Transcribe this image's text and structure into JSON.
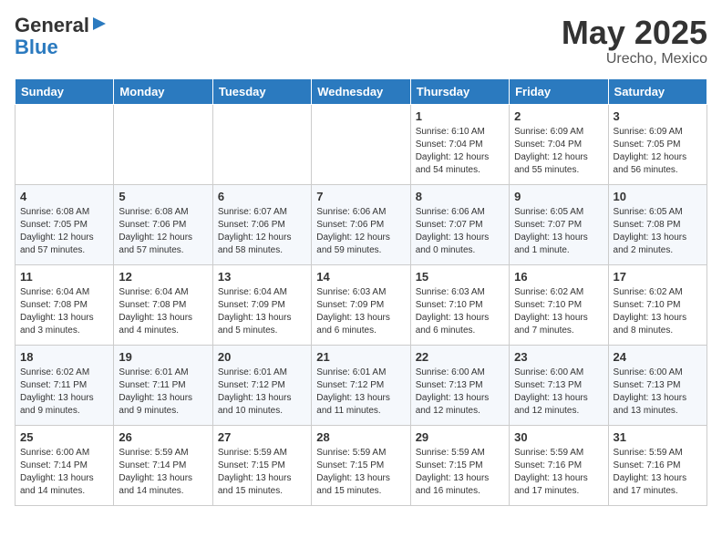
{
  "header": {
    "logo_general": "General",
    "logo_blue": "Blue",
    "title": "May 2025",
    "subtitle": "Urecho, Mexico"
  },
  "days_of_week": [
    "Sunday",
    "Monday",
    "Tuesday",
    "Wednesday",
    "Thursday",
    "Friday",
    "Saturday"
  ],
  "weeks": [
    [
      {
        "day": "",
        "info": ""
      },
      {
        "day": "",
        "info": ""
      },
      {
        "day": "",
        "info": ""
      },
      {
        "day": "",
        "info": ""
      },
      {
        "day": "1",
        "info": "Sunrise: 6:10 AM\nSunset: 7:04 PM\nDaylight: 12 hours\nand 54 minutes."
      },
      {
        "day": "2",
        "info": "Sunrise: 6:09 AM\nSunset: 7:04 PM\nDaylight: 12 hours\nand 55 minutes."
      },
      {
        "day": "3",
        "info": "Sunrise: 6:09 AM\nSunset: 7:05 PM\nDaylight: 12 hours\nand 56 minutes."
      }
    ],
    [
      {
        "day": "4",
        "info": "Sunrise: 6:08 AM\nSunset: 7:05 PM\nDaylight: 12 hours\nand 57 minutes."
      },
      {
        "day": "5",
        "info": "Sunrise: 6:08 AM\nSunset: 7:06 PM\nDaylight: 12 hours\nand 57 minutes."
      },
      {
        "day": "6",
        "info": "Sunrise: 6:07 AM\nSunset: 7:06 PM\nDaylight: 12 hours\nand 58 minutes."
      },
      {
        "day": "7",
        "info": "Sunrise: 6:06 AM\nSunset: 7:06 PM\nDaylight: 12 hours\nand 59 minutes."
      },
      {
        "day": "8",
        "info": "Sunrise: 6:06 AM\nSunset: 7:07 PM\nDaylight: 13 hours\nand 0 minutes."
      },
      {
        "day": "9",
        "info": "Sunrise: 6:05 AM\nSunset: 7:07 PM\nDaylight: 13 hours\nand 1 minute."
      },
      {
        "day": "10",
        "info": "Sunrise: 6:05 AM\nSunset: 7:08 PM\nDaylight: 13 hours\nand 2 minutes."
      }
    ],
    [
      {
        "day": "11",
        "info": "Sunrise: 6:04 AM\nSunset: 7:08 PM\nDaylight: 13 hours\nand 3 minutes."
      },
      {
        "day": "12",
        "info": "Sunrise: 6:04 AM\nSunset: 7:08 PM\nDaylight: 13 hours\nand 4 minutes."
      },
      {
        "day": "13",
        "info": "Sunrise: 6:04 AM\nSunset: 7:09 PM\nDaylight: 13 hours\nand 5 minutes."
      },
      {
        "day": "14",
        "info": "Sunrise: 6:03 AM\nSunset: 7:09 PM\nDaylight: 13 hours\nand 6 minutes."
      },
      {
        "day": "15",
        "info": "Sunrise: 6:03 AM\nSunset: 7:10 PM\nDaylight: 13 hours\nand 6 minutes."
      },
      {
        "day": "16",
        "info": "Sunrise: 6:02 AM\nSunset: 7:10 PM\nDaylight: 13 hours\nand 7 minutes."
      },
      {
        "day": "17",
        "info": "Sunrise: 6:02 AM\nSunset: 7:10 PM\nDaylight: 13 hours\nand 8 minutes."
      }
    ],
    [
      {
        "day": "18",
        "info": "Sunrise: 6:02 AM\nSunset: 7:11 PM\nDaylight: 13 hours\nand 9 minutes."
      },
      {
        "day": "19",
        "info": "Sunrise: 6:01 AM\nSunset: 7:11 PM\nDaylight: 13 hours\nand 9 minutes."
      },
      {
        "day": "20",
        "info": "Sunrise: 6:01 AM\nSunset: 7:12 PM\nDaylight: 13 hours\nand 10 minutes."
      },
      {
        "day": "21",
        "info": "Sunrise: 6:01 AM\nSunset: 7:12 PM\nDaylight: 13 hours\nand 11 minutes."
      },
      {
        "day": "22",
        "info": "Sunrise: 6:00 AM\nSunset: 7:13 PM\nDaylight: 13 hours\nand 12 minutes."
      },
      {
        "day": "23",
        "info": "Sunrise: 6:00 AM\nSunset: 7:13 PM\nDaylight: 13 hours\nand 12 minutes."
      },
      {
        "day": "24",
        "info": "Sunrise: 6:00 AM\nSunset: 7:13 PM\nDaylight: 13 hours\nand 13 minutes."
      }
    ],
    [
      {
        "day": "25",
        "info": "Sunrise: 6:00 AM\nSunset: 7:14 PM\nDaylight: 13 hours\nand 14 minutes."
      },
      {
        "day": "26",
        "info": "Sunrise: 5:59 AM\nSunset: 7:14 PM\nDaylight: 13 hours\nand 14 minutes."
      },
      {
        "day": "27",
        "info": "Sunrise: 5:59 AM\nSunset: 7:15 PM\nDaylight: 13 hours\nand 15 minutes."
      },
      {
        "day": "28",
        "info": "Sunrise: 5:59 AM\nSunset: 7:15 PM\nDaylight: 13 hours\nand 15 minutes."
      },
      {
        "day": "29",
        "info": "Sunrise: 5:59 AM\nSunset: 7:15 PM\nDaylight: 13 hours\nand 16 minutes."
      },
      {
        "day": "30",
        "info": "Sunrise: 5:59 AM\nSunset: 7:16 PM\nDaylight: 13 hours\nand 17 minutes."
      },
      {
        "day": "31",
        "info": "Sunrise: 5:59 AM\nSunset: 7:16 PM\nDaylight: 13 hours\nand 17 minutes."
      }
    ]
  ]
}
